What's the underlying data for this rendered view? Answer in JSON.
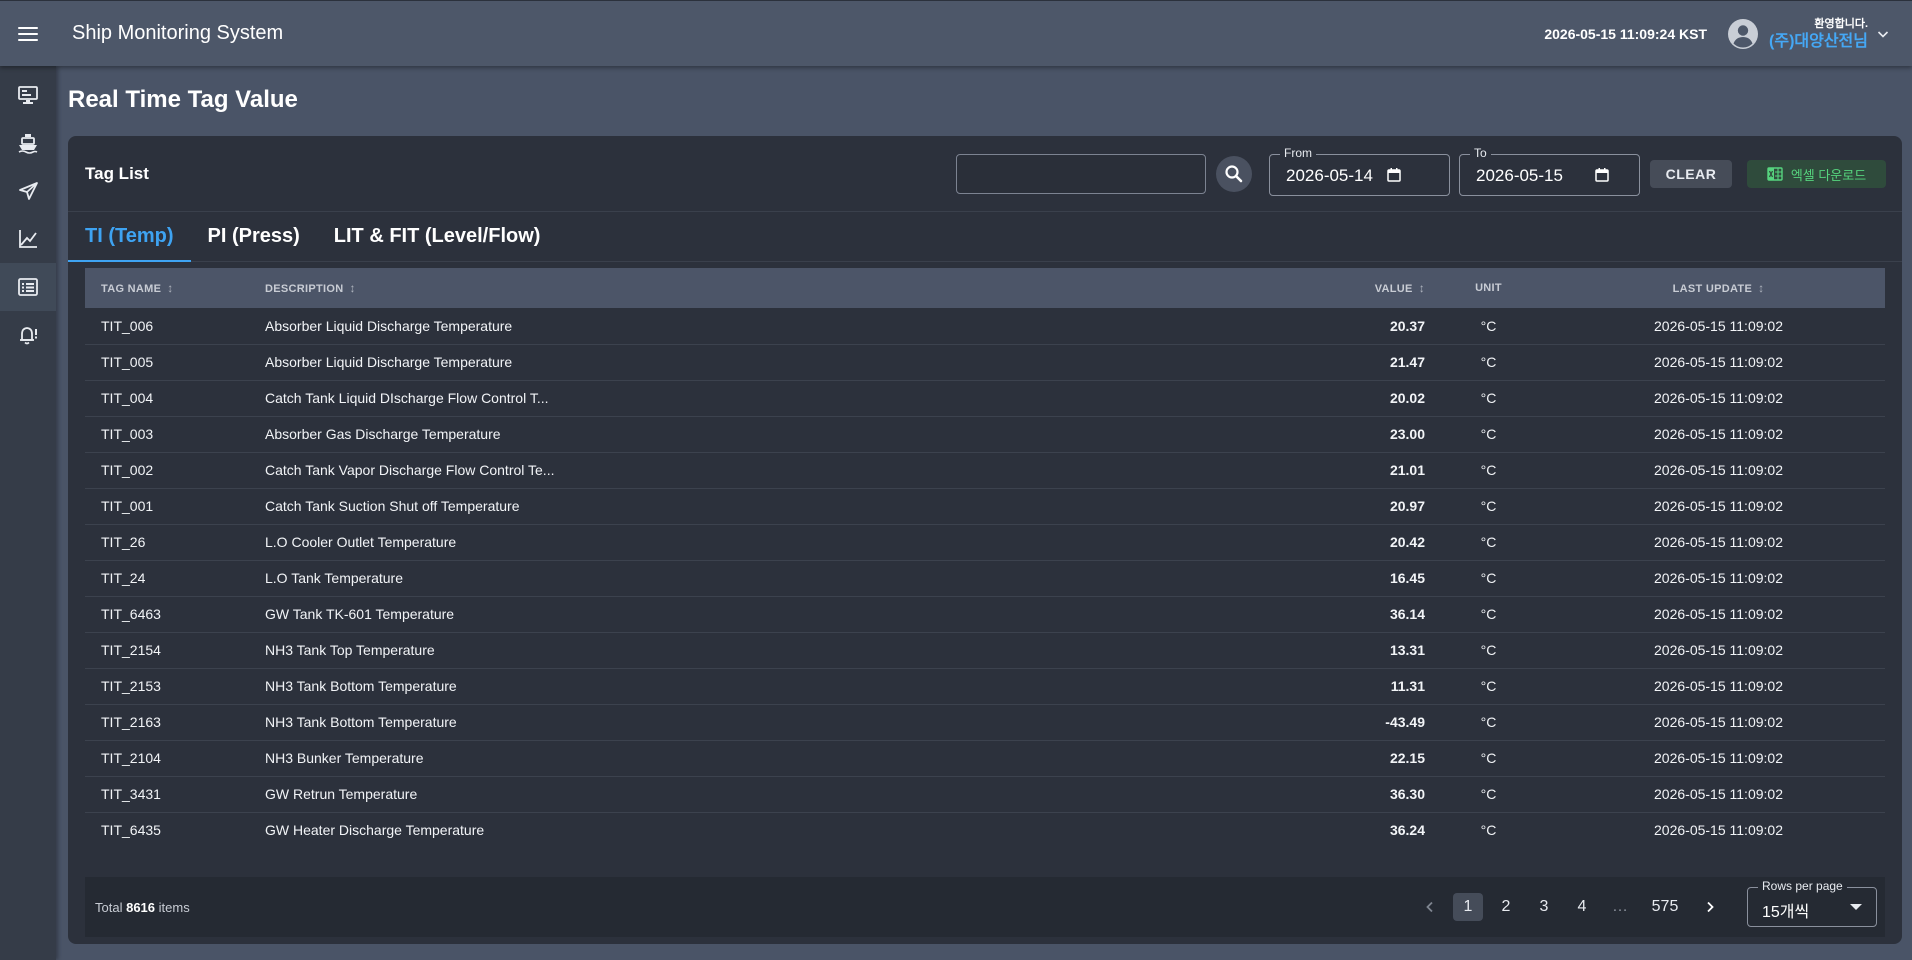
{
  "app": {
    "title": "Ship Monitoring System",
    "clock": "2026-05-15 11:09:24 KST",
    "welcome": "환영합니다.",
    "user_name": "(주)대양산전님"
  },
  "sidebar": {
    "items": [
      {
        "icon": "monitor-icon"
      },
      {
        "icon": "ship-icon"
      },
      {
        "icon": "navigation-icon"
      },
      {
        "icon": "line-chart-icon"
      },
      {
        "icon": "list-icon",
        "active": true
      },
      {
        "icon": "alarm-bell-icon"
      }
    ]
  },
  "page": {
    "title": "Real Time Tag Value"
  },
  "toolbar": {
    "card_title": "Tag List",
    "search_value": "",
    "from_label": "From",
    "from_value": "2026-05-14",
    "to_label": "To",
    "to_value": "2026-05-15",
    "clear_label": "CLEAR",
    "excel_label": "엑셀 다운로드"
  },
  "tabs": [
    {
      "label": "TI (Temp)",
      "active": true
    },
    {
      "label": "PI (Press)",
      "active": false
    },
    {
      "label": "LIT & FIT (Level/Flow)",
      "active": false
    }
  ],
  "table": {
    "headers": {
      "tag": "TAG NAME",
      "desc": "DESCRIPTION",
      "value": "VALUE",
      "unit": "UNIT",
      "update": "LAST UPDATE"
    },
    "rows": [
      {
        "tag": "TIT_006",
        "desc": "Absorber Liquid Discharge Temperature",
        "value": "20.37",
        "unit": "°C",
        "update": "2026-05-15 11:09:02"
      },
      {
        "tag": "TIT_005",
        "desc": "Absorber Liquid Discharge Temperature",
        "value": "21.47",
        "unit": "°C",
        "update": "2026-05-15 11:09:02"
      },
      {
        "tag": "TIT_004",
        "desc": "Catch Tank Liquid DIscharge Flow Control T...",
        "value": "20.02",
        "unit": "°C",
        "update": "2026-05-15 11:09:02"
      },
      {
        "tag": "TIT_003",
        "desc": "Absorber Gas Discharge Temperature",
        "value": "23.00",
        "unit": "°C",
        "update": "2026-05-15 11:09:02"
      },
      {
        "tag": "TIT_002",
        "desc": "Catch Tank Vapor Discharge Flow Control Te...",
        "value": "21.01",
        "unit": "°C",
        "update": "2026-05-15 11:09:02"
      },
      {
        "tag": "TIT_001",
        "desc": "Catch Tank Suction Shut off Temperature",
        "value": "20.97",
        "unit": "°C",
        "update": "2026-05-15 11:09:02"
      },
      {
        "tag": "TIT_26",
        "desc": "L.O Cooler Outlet Temperature",
        "value": "20.42",
        "unit": "°C",
        "update": "2026-05-15 11:09:02"
      },
      {
        "tag": "TIT_24",
        "desc": "L.O Tank Temperature",
        "value": "16.45",
        "unit": "°C",
        "update": "2026-05-15 11:09:02"
      },
      {
        "tag": "TIT_6463",
        "desc": "GW Tank TK-601 Temperature",
        "value": "36.14",
        "unit": "°C",
        "update": "2026-05-15 11:09:02"
      },
      {
        "tag": "TIT_2154",
        "desc": "NH3 Tank Top Temperature",
        "value": "13.31",
        "unit": "°C",
        "update": "2026-05-15 11:09:02"
      },
      {
        "tag": "TIT_2153",
        "desc": "NH3 Tank Bottom Temperature",
        "value": "11.31",
        "unit": "°C",
        "update": "2026-05-15 11:09:02"
      },
      {
        "tag": "TIT_2163",
        "desc": "NH3 Tank Bottom Temperature",
        "value": "-43.49",
        "unit": "°C",
        "update": "2026-05-15 11:09:02"
      },
      {
        "tag": "TIT_2104",
        "desc": "NH3 Bunker Temperature",
        "value": "22.15",
        "unit": "°C",
        "update": "2026-05-15 11:09:02"
      },
      {
        "tag": "TIT_3431",
        "desc": "GW Retrun Temperature",
        "value": "36.30",
        "unit": "°C",
        "update": "2026-05-15 11:09:02"
      },
      {
        "tag": "TIT_6435",
        "desc": "GW Heater Discharge Temperature",
        "value": "36.24",
        "unit": "°C",
        "update": "2026-05-15 11:09:02"
      }
    ]
  },
  "footer": {
    "total_prefix": "Total",
    "total_count": "8616",
    "total_suffix": "items",
    "pages": [
      "1",
      "2",
      "3",
      "4",
      "…",
      "575"
    ],
    "current_page": "1",
    "rows_per_page_label": "Rows per page",
    "rows_per_page_value": "15개씩"
  }
}
